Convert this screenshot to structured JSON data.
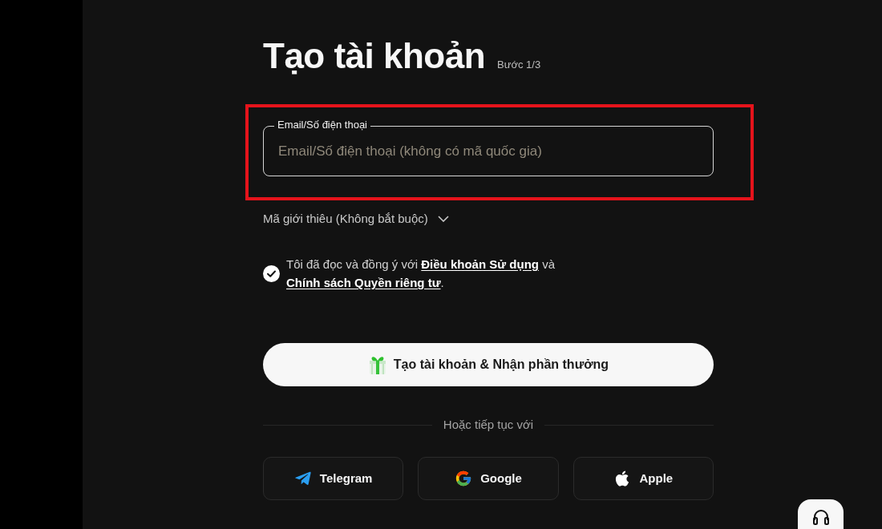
{
  "title": "Tạo tài khoản",
  "step": "Bước 1/3",
  "contact_field": {
    "label": "Email/Số điện thoại",
    "placeholder": "Email/Số điện thoại (không có mã quốc gia)",
    "highlighted": true
  },
  "referral_toggle": {
    "label": "Mã giới thiêu (Không bắt buộc)",
    "expanded": false
  },
  "consent": {
    "checked": true,
    "parts": [
      {
        "kind": "text",
        "text": "Tôi đã đọc và đồng ý với "
      },
      {
        "kind": "link",
        "text": "Điều khoản Sử dụng"
      },
      {
        "kind": "text",
        "text": " và "
      },
      {
        "kind": "link",
        "text": "Chính sách Quyền riêng tư"
      },
      {
        "kind": "text",
        "text": "."
      }
    ]
  },
  "primary_button": {
    "label": "Tạo tài khoản & Nhận phần thưởng"
  },
  "divider_text": "Hoặc tiếp tục với",
  "social_buttons": [
    {
      "kind": "telegram",
      "label": "Telegram"
    },
    {
      "kind": "google",
      "label": "Google"
    },
    {
      "kind": "apple",
      "label": "Apple"
    }
  ]
}
